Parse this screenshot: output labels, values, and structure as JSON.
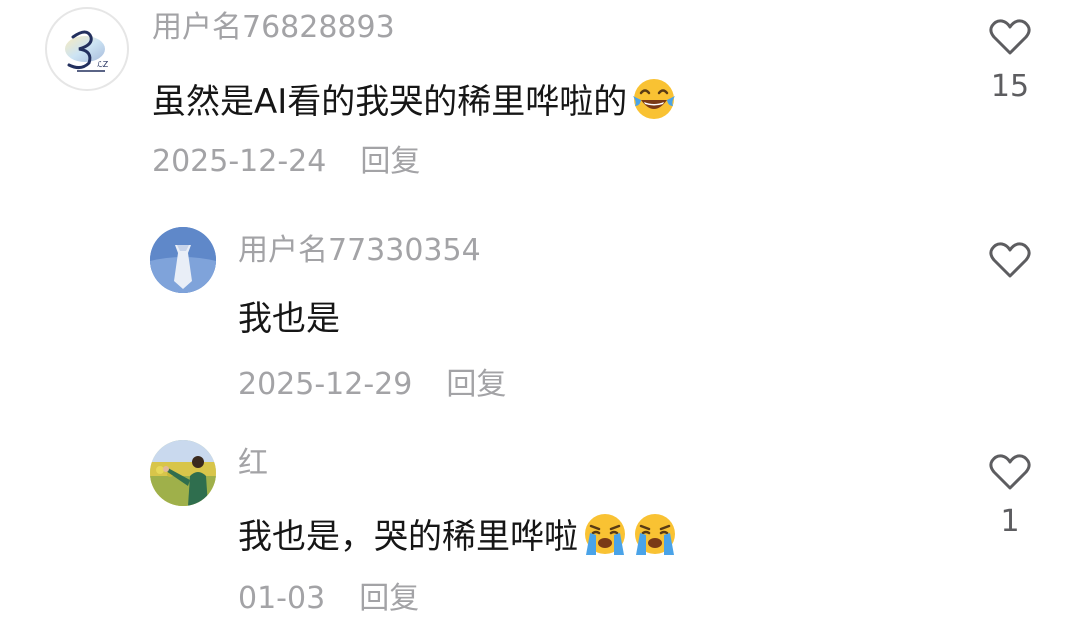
{
  "comments": [
    {
      "username": "用户名76828893",
      "text": "虽然是AI看的我哭的稀里哗啦的",
      "emojis": [
        "laughing-tears-emoji"
      ],
      "date": "2025-12-24",
      "reply_label": "回复",
      "like_count": "15",
      "avatar": "logo-avatar"
    },
    {
      "username": "用户名77330354",
      "text": "我也是",
      "emojis": [],
      "date": "2025-12-29",
      "reply_label": "回复",
      "like_count": "",
      "avatar": "tie-avatar"
    },
    {
      "username": "红",
      "text": "我也是，哭的稀里哗啦",
      "emojis": [
        "crying-emoji",
        "crying-emoji"
      ],
      "date": "01-03",
      "reply_label": "回复",
      "like_count": "1",
      "avatar": "photo-avatar"
    }
  ],
  "colors": {
    "username": "#a3a3a6",
    "text": "#161616",
    "meta": "#a3a3a6",
    "heart_outline": "#5d5d60",
    "emoji_yellow": "#f9c233",
    "tear_blue": "#4aa3e8"
  }
}
